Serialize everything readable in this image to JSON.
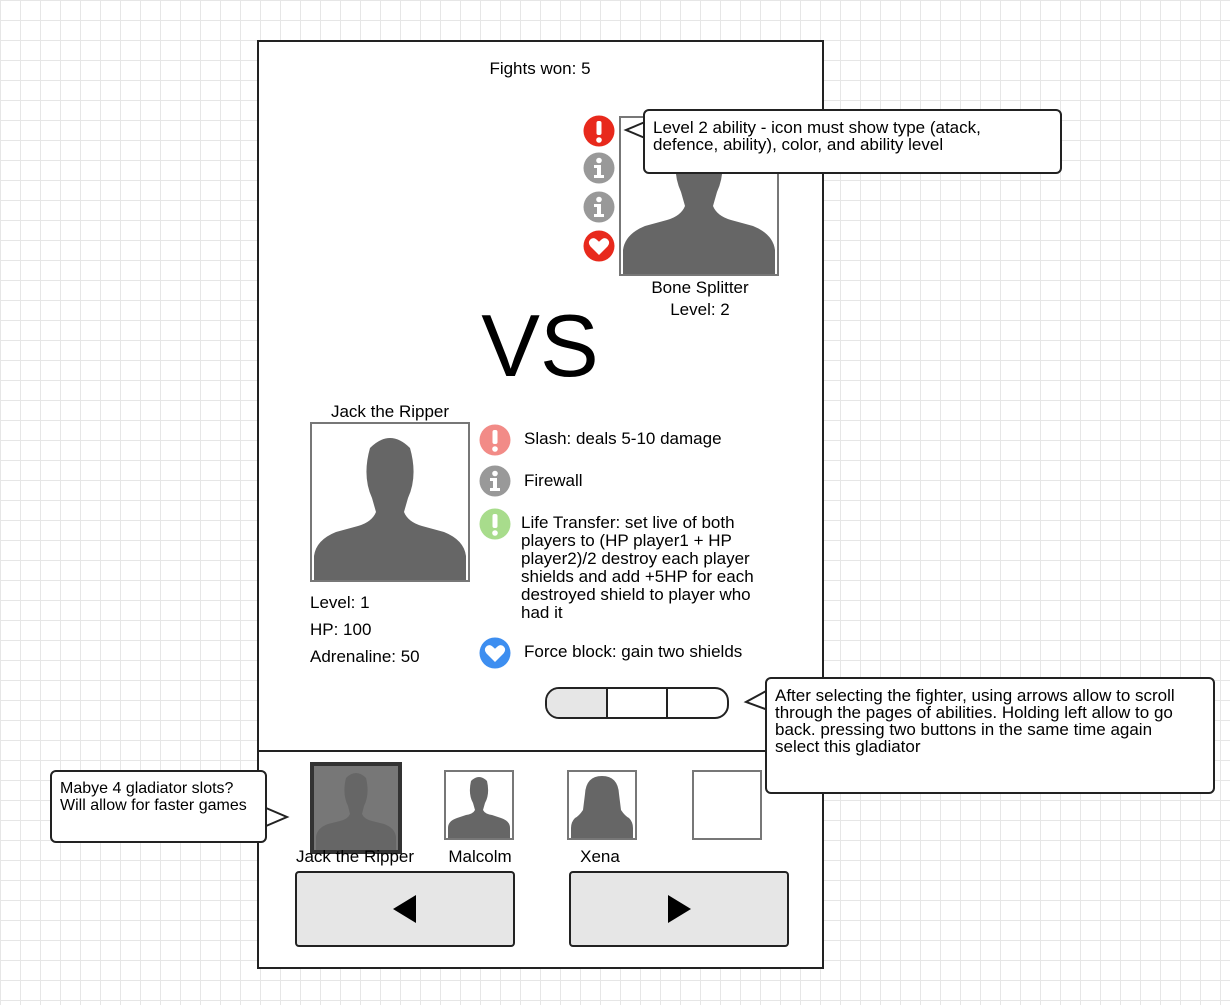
{
  "header": {
    "fights_won": "Fights won: 5"
  },
  "opponent": {
    "name": "Bone Splitter",
    "level": "Level: 2",
    "ability_icons": [
      {
        "icon": "exclamation-icon",
        "color": "#e8291c"
      },
      {
        "icon": "info-icon",
        "color": "#999999"
      },
      {
        "icon": "info-icon",
        "color": "#999999"
      },
      {
        "icon": "heart-icon",
        "color": "#e8291c"
      }
    ]
  },
  "versus": "VS",
  "player": {
    "name": "Jack the Ripper",
    "level": "Level: 1",
    "hp": "HP: 100",
    "adrenaline": "Adrenaline: 50",
    "abilities": [
      {
        "icon": "exclamation-icon",
        "color": "#f28b87",
        "label": "Slash: deals 5-10 damage"
      },
      {
        "icon": "info-icon",
        "color": "#999999",
        "label": "Firewall"
      },
      {
        "icon": "exclamation-icon",
        "color": "#a8dc8c",
        "label": "Life Transfer: set live of both\nplayers to (HP player1 + HP\nplayer2)/2 destroy each player\nshields and add +5HP for each\ndestroyed shield to player who\nhad it"
      },
      {
        "icon": "heart-icon",
        "color": "#3d8ef0",
        "label": "Force block: gain two shields"
      }
    ]
  },
  "pager": {
    "pages": 3,
    "current": 1
  },
  "roster": [
    {
      "name": "Jack the Ripper",
      "avatar": "male",
      "selected": true
    },
    {
      "name": "Malcolm",
      "avatar": "male",
      "selected": false
    },
    {
      "name": "Xena",
      "avatar": "female",
      "selected": false
    },
    {
      "name": "",
      "avatar": "empty",
      "selected": false
    }
  ],
  "nav": {
    "prev_icon": "triangle-left-icon",
    "next_icon": "triangle-right-icon"
  },
  "notes": {
    "ability_level": "Level 2 ability - icon must show type (atack,\ndefence, ability), color, and ability level",
    "scroll": "After selecting the fighter, using arrows allow to scroll\nthrough the pages of abilities. Holding left allow to go\nback. pressing two buttons in the same time again\nselect this gladiator",
    "slots": "Mabye 4 gladiator slots?\nWill allow for faster games"
  }
}
